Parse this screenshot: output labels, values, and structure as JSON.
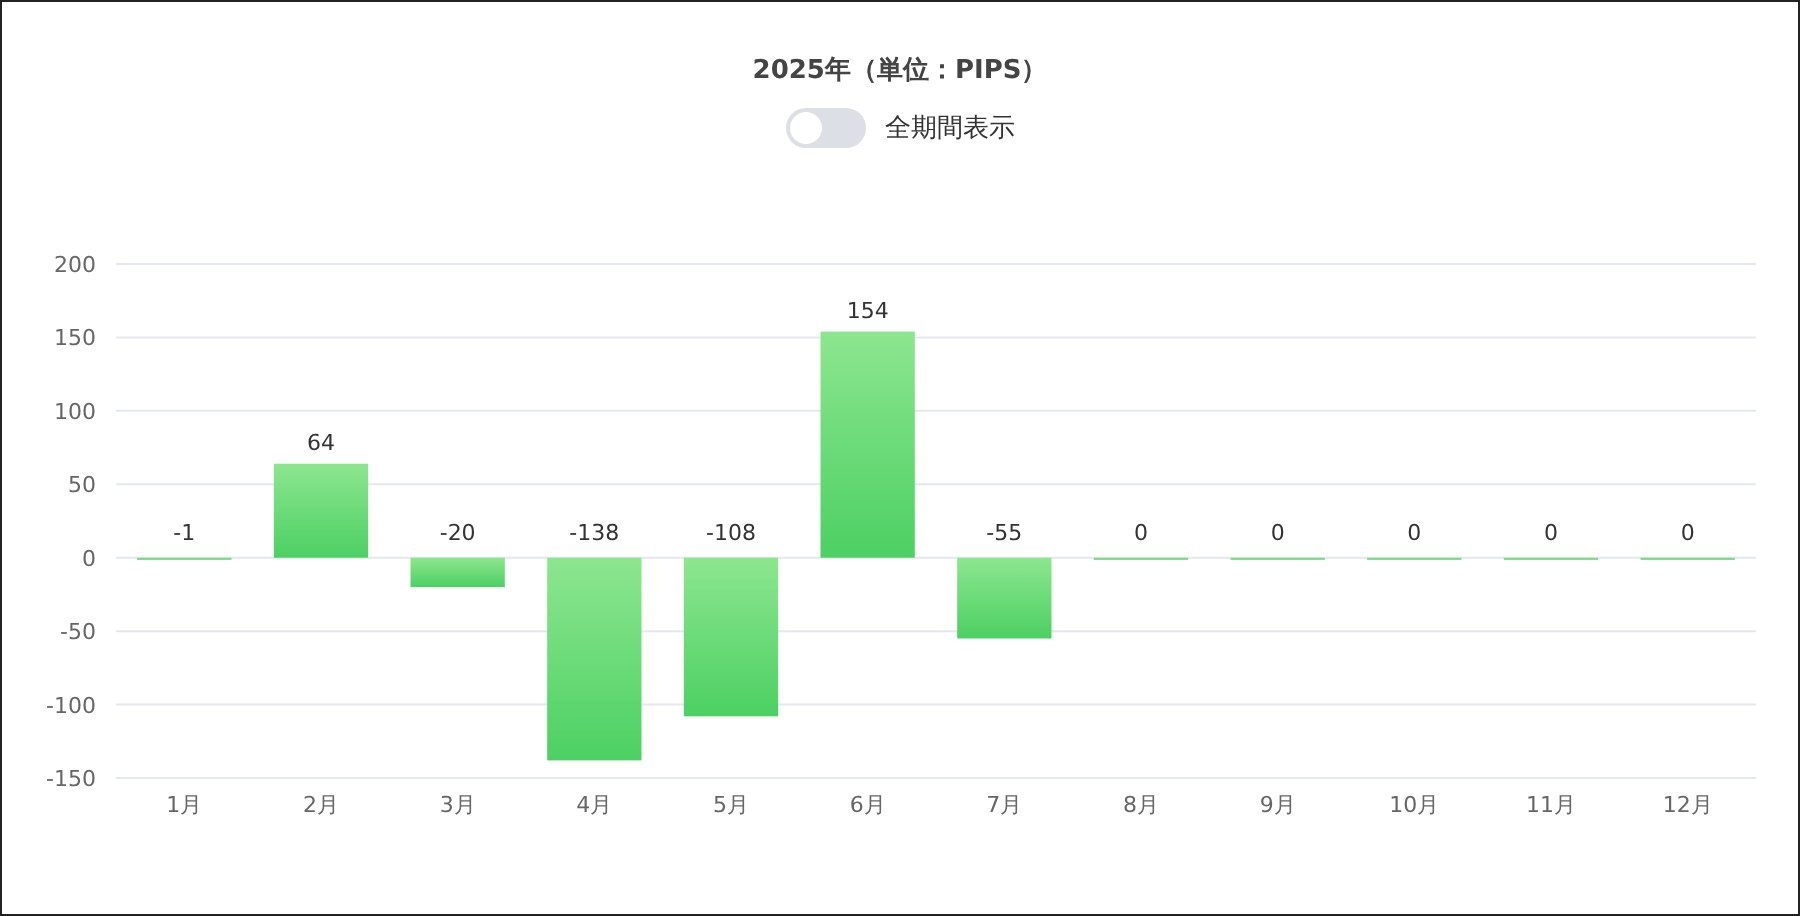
{
  "title": "2025年（単位：PIPS）",
  "toggle": {
    "label": "全期間表示",
    "on": false
  },
  "chart_data": {
    "type": "bar",
    "categories": [
      "1月",
      "2月",
      "3月",
      "4月",
      "5月",
      "6月",
      "7月",
      "8月",
      "9月",
      "10月",
      "11月",
      "12月"
    ],
    "series": [
      {
        "color": "#4cd063",
        "values": [
          -1,
          64,
          -20,
          -138,
          -108,
          154,
          -55,
          0,
          0,
          0,
          0,
          0
        ]
      }
    ],
    "ylim": [
      -150,
      200
    ],
    "yticks": [
      -150,
      -100,
      -50,
      0,
      50,
      100,
      150,
      200
    ],
    "data_labels": true,
    "grid": true
  }
}
